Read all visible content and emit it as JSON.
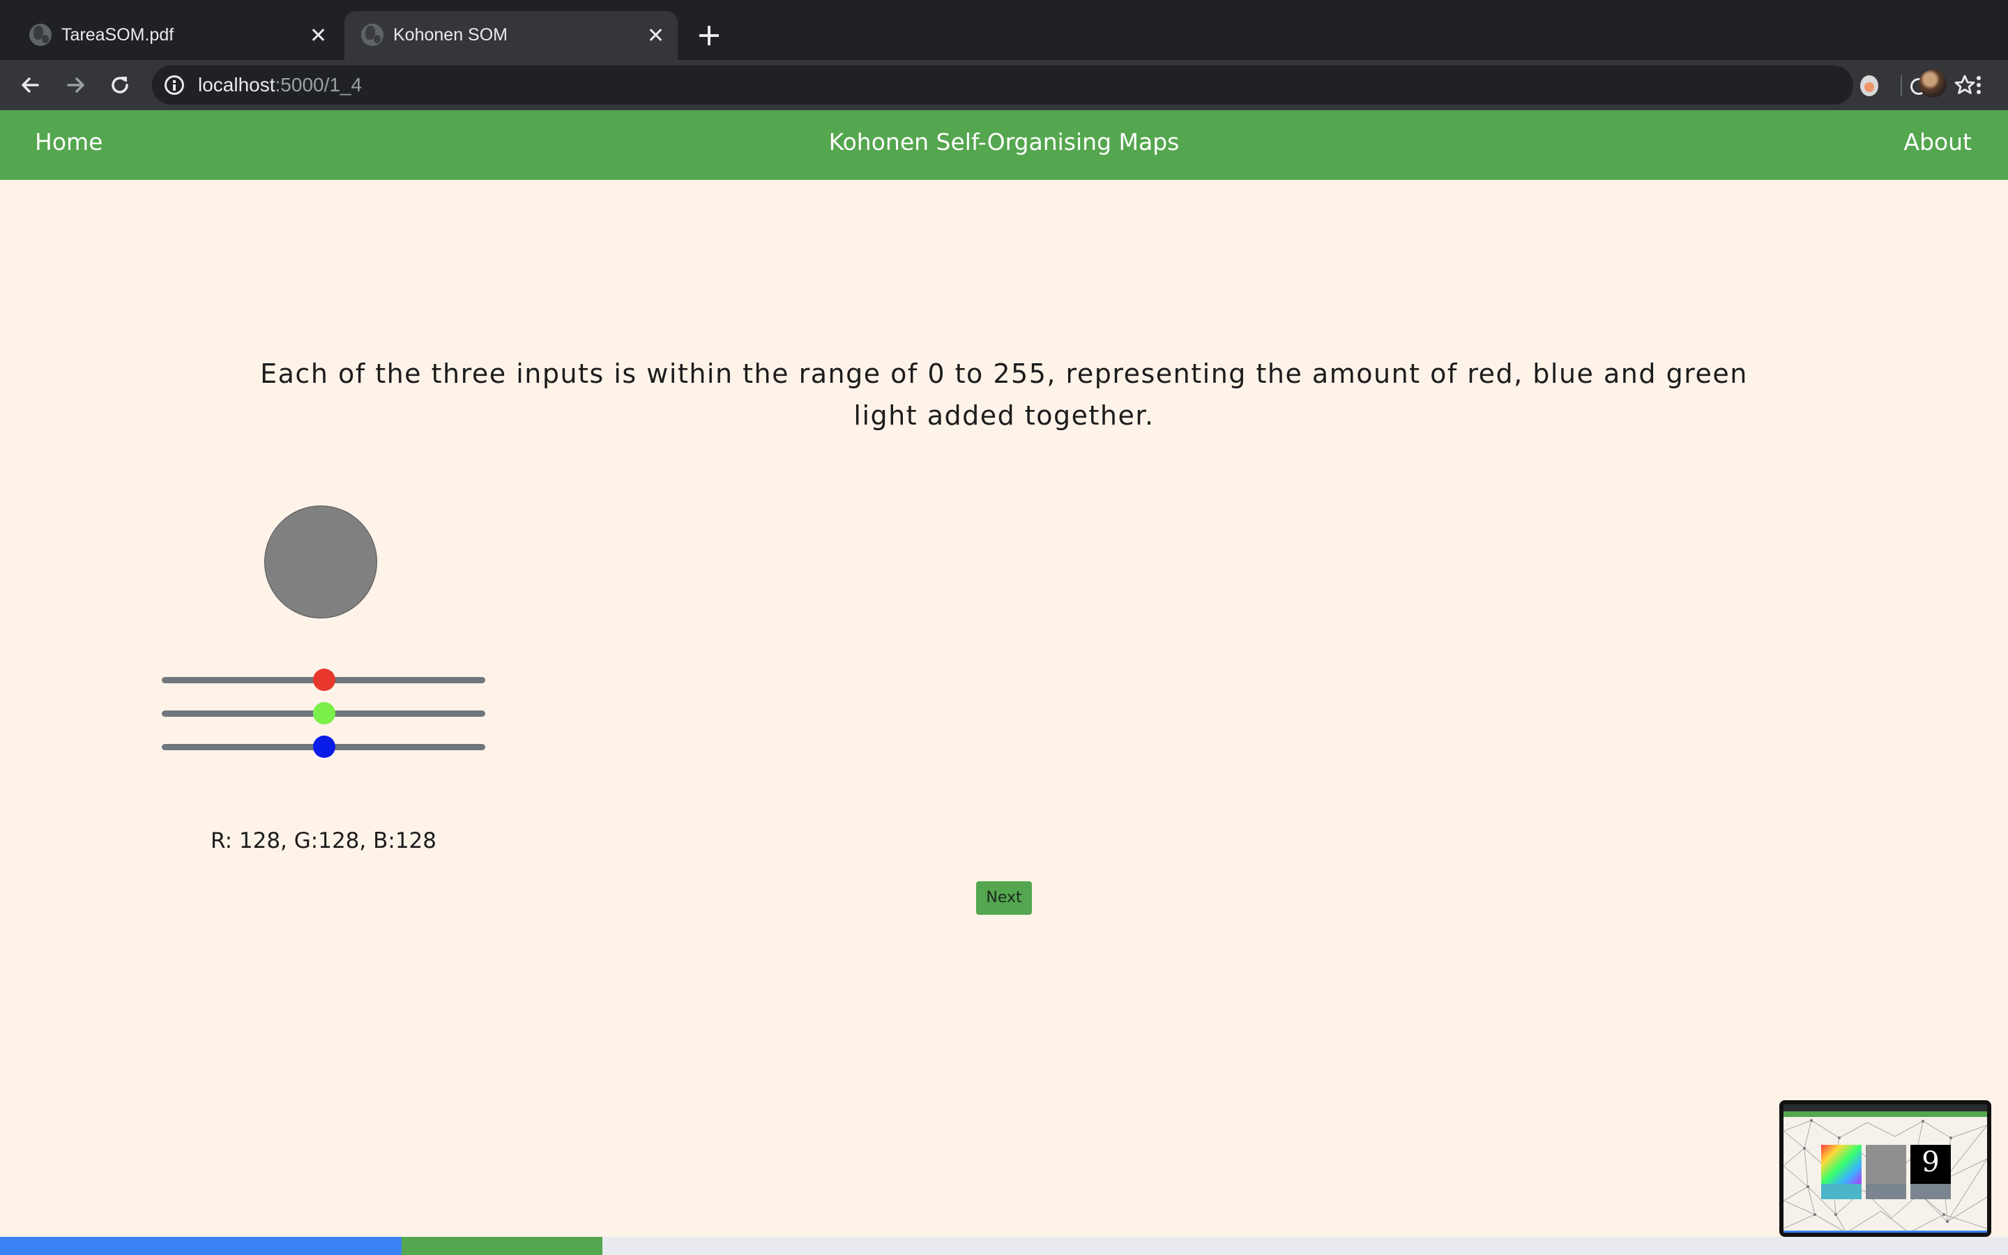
{
  "browser": {
    "tabs": [
      {
        "title": "TareaSOM.pdf",
        "active": false,
        "favicon": "globe-icon"
      },
      {
        "title": "Kohonen SOM",
        "active": true,
        "favicon": "globe-icon"
      }
    ],
    "url_host": "localhost",
    "url_rest": ":5000/1_4",
    "toolbar_icons": [
      "back-arrow-icon",
      "forward-arrow-icon",
      "reload-icon",
      "info-icon",
      "zoom-icon",
      "star-icon",
      "extension-icon",
      "avatar",
      "kebab-menu-icon"
    ]
  },
  "nav": {
    "home": "Home",
    "title": "Kohonen Self-Organising Maps",
    "about": "About",
    "color": "#54a64f"
  },
  "content": {
    "description": "Each of the three inputs is within the range of 0 to 255, representing the amount of red, blue and green light added together.",
    "rgb": {
      "r": 128,
      "g": 128,
      "b": 128
    },
    "slider_min": 0,
    "slider_max": 255,
    "slider_colors": {
      "red": "#e8382e",
      "green": "#7bf04a",
      "blue": "#0a1de8"
    },
    "readout": "R: 128, G:128, B:128",
    "next_label": "Next"
  },
  "progress": {
    "blue_fraction": 0.2,
    "green_fraction": 0.1,
    "colors": {
      "blue": "#3b82f6",
      "green": "#54a64f",
      "track": "#e9ebee"
    }
  },
  "pip_thumbnail": {
    "description_icons": [
      "color-map-card",
      "skeleton-card",
      "digit-card"
    ],
    "digit": "9"
  }
}
